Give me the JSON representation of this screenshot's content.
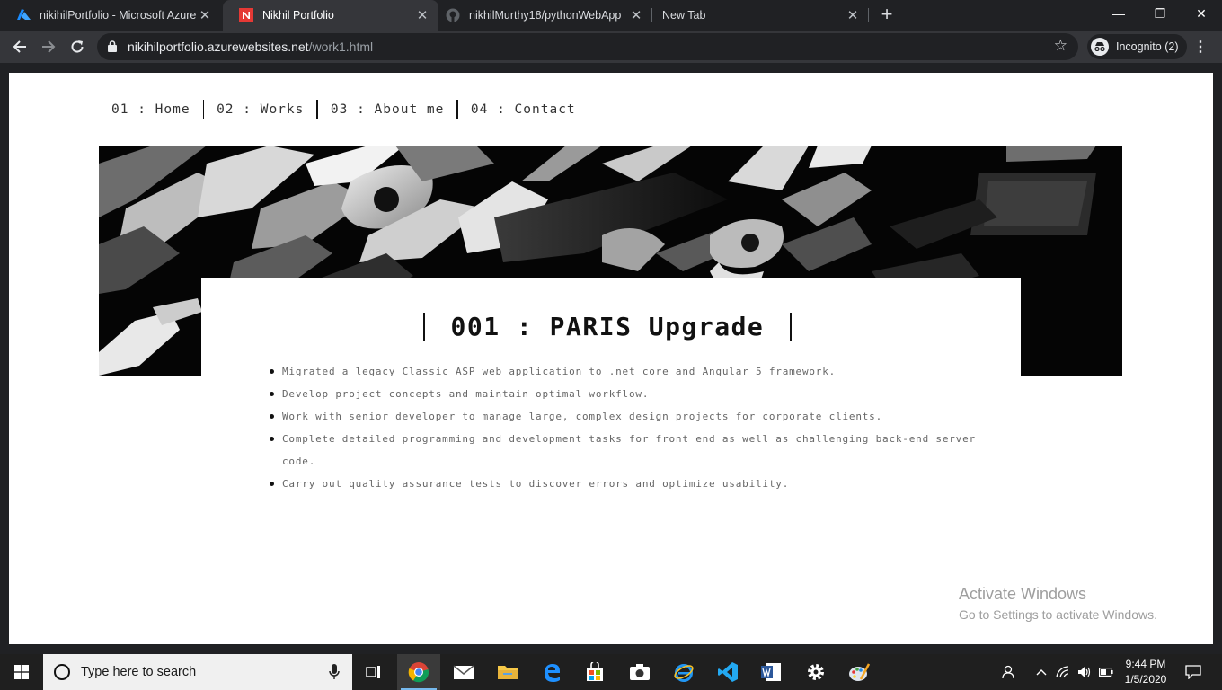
{
  "browser": {
    "tabs": [
      {
        "label": "nikihilPortfolio - Microsoft Azure",
        "active": false,
        "favicon": "azure-icon"
      },
      {
        "label": "Nikhil Portfolio",
        "active": true,
        "favicon": "n-logo-icon"
      },
      {
        "label": "nikhilMurthy18/pythonWebApp",
        "active": false,
        "favicon": "github-icon"
      },
      {
        "label": "New Tab",
        "active": false,
        "favicon": ""
      }
    ],
    "close_glyph": "✕",
    "new_tab_glyph": "+",
    "window_controls": {
      "minimize": "—",
      "restore": "❐",
      "close": "✕"
    },
    "address": {
      "host": "nikihilportfolio.azurewebsites.net",
      "path": "/work1.html"
    },
    "incognito_label": "Incognito (2)"
  },
  "site": {
    "nav": [
      {
        "label": "01 : Home"
      },
      {
        "label": "02 : Works"
      },
      {
        "label": "03 : About me"
      },
      {
        "label": "04 : Contact"
      }
    ],
    "project_title": "001 : PARIS Upgrade",
    "bullets": [
      "Migrated a legacy Classic ASP web application to .net core and Angular 5 framework.",
      "Develop project concepts and maintain optimal workflow.",
      "Work with senior developer to manage large, complex design projects for corporate clients.",
      "Complete detailed programming and development tasks for front end as well as challenging back-end server code.",
      "Carry out quality assurance tests to discover errors and optimize usability."
    ]
  },
  "watermark": {
    "line1": "Activate Windows",
    "line2": "Go to Settings to activate Windows."
  },
  "taskbar": {
    "search_placeholder": "Type here to search",
    "time": "9:44 PM",
    "date": "1/5/2020"
  },
  "colors": {
    "accent": "#76b9ed",
    "tab_active": "#35363a",
    "chrome_dark": "#202124"
  }
}
